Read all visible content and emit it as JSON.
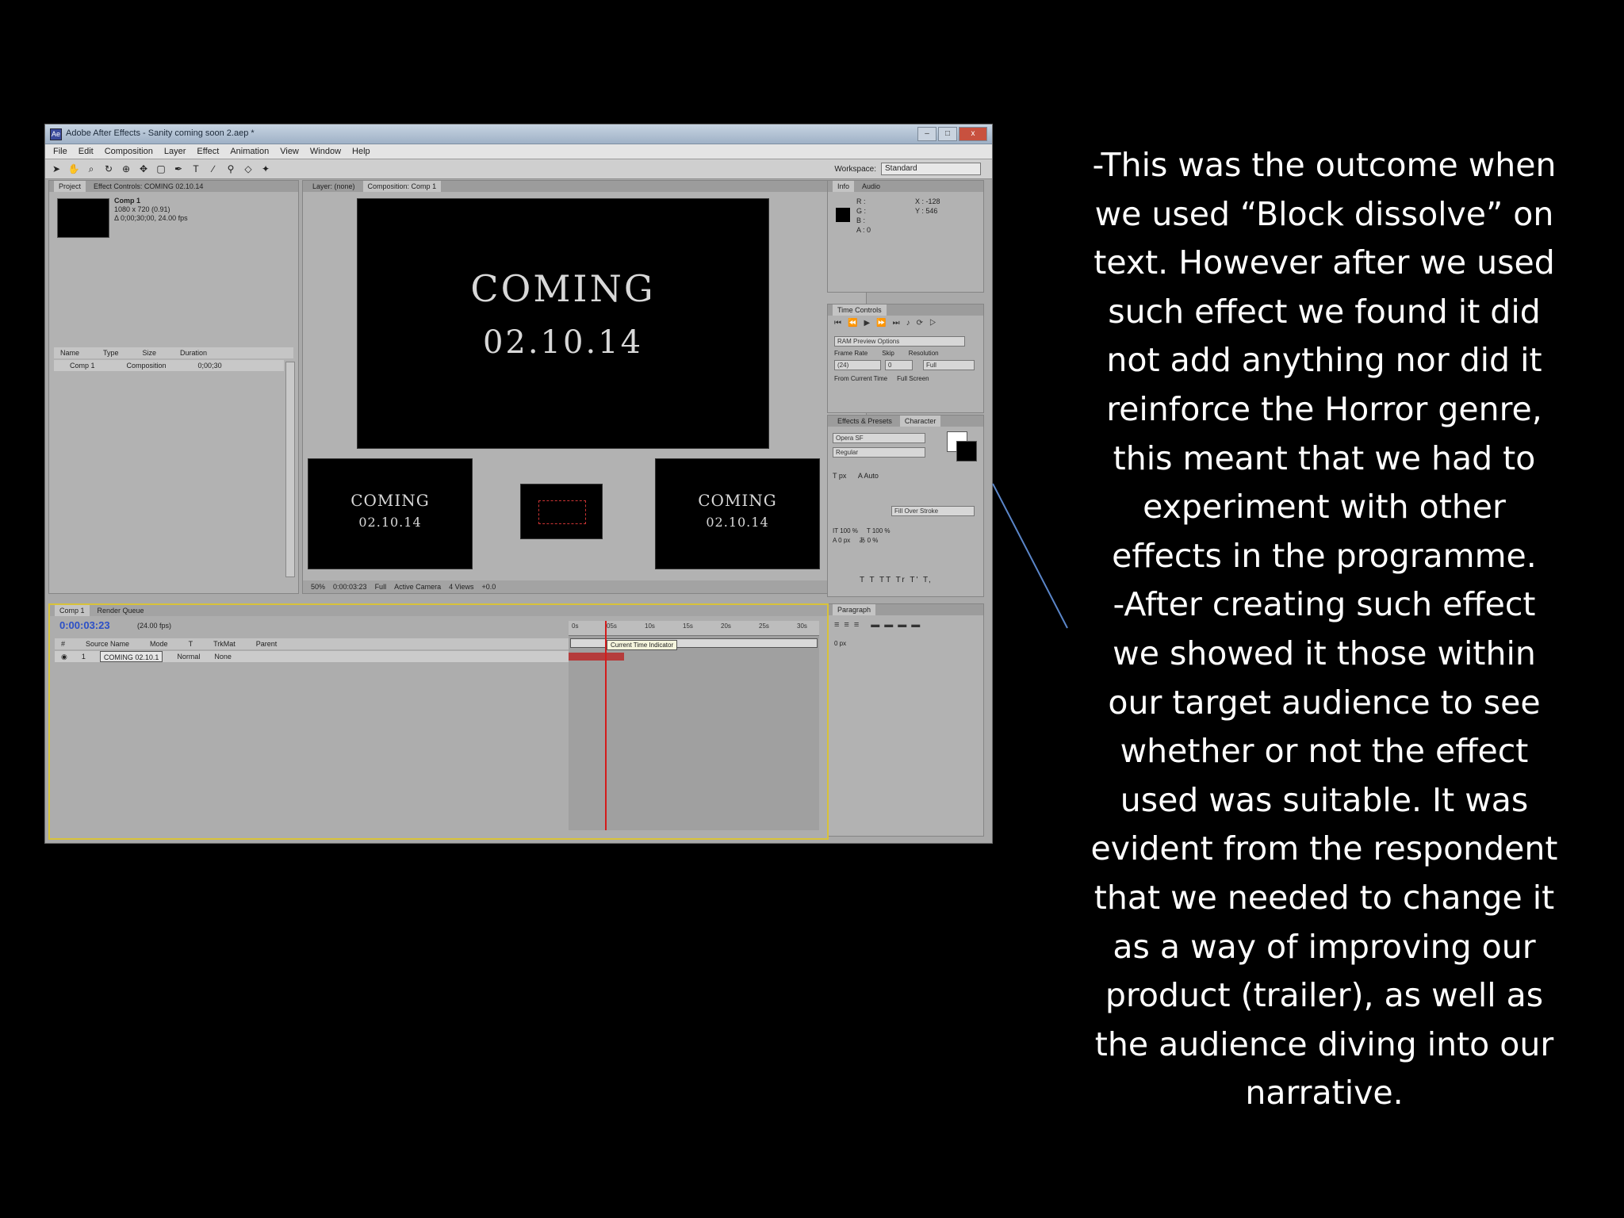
{
  "window": {
    "title": "Adobe After Effects - Sanity coming soon 2.aep *",
    "buttons": {
      "minimize": "–",
      "maximize": "□",
      "close": "x"
    }
  },
  "menu": [
    "File",
    "Edit",
    "Composition",
    "Layer",
    "Effect",
    "Animation",
    "View",
    "Window",
    "Help"
  ],
  "workspace": {
    "label": "Workspace:",
    "value": "Standard"
  },
  "project_panel": {
    "tabs": [
      "Project",
      "Effect Controls: COMING 02.10.14"
    ],
    "comp_name": "Comp 1",
    "comp_size": "1080 x 720 (0.91)",
    "comp_duration": "Δ 0;00;30;00, 24.00 fps",
    "columns": [
      "Name",
      "Type",
      "Size",
      "Duration"
    ],
    "row": {
      "name": "Comp 1",
      "type": "Composition",
      "duration": "0;00;30"
    }
  },
  "composition_panel": {
    "tabs": [
      "Layer: (none)",
      "Composition: Comp 1"
    ],
    "title_text": "COMING",
    "date_text": "02.10.14",
    "status": [
      "50%",
      "0:00:03:23",
      "Full",
      "Active Camera",
      "4 Views",
      "+0.0"
    ]
  },
  "info_panel": {
    "tabs": [
      "Info",
      "Audio"
    ],
    "r": "R :",
    "g": "G :",
    "b": "B :",
    "a": "A : 0",
    "x": "X : -128",
    "y": "Y : 546"
  },
  "time_controls": {
    "tab": "Time Controls",
    "ram_preview": "RAM Preview Options",
    "labels": [
      "Frame Rate",
      "Skip",
      "Resolution"
    ],
    "values": [
      "(24)",
      "0",
      "Full"
    ],
    "checks": [
      "From Current Time",
      "Full Screen"
    ]
  },
  "character_panel": {
    "tabs": [
      "Effects & Presets",
      "Character"
    ],
    "font": "Opera SF",
    "style": "Regular",
    "size": "px",
    "leading": "Auto",
    "stroke": "Fill Over Stroke",
    "scale_v": "100 %",
    "scale_h": "100 %",
    "baseline": "0 px",
    "tsume": "0 %",
    "styles": "T T TT Tr T' T,"
  },
  "paragraph_panel": {
    "tab": "Paragraph",
    "indent": "0 px"
  },
  "timeline": {
    "tabs": [
      "Comp 1",
      "Render Queue"
    ],
    "timecode": "0:00:03:23",
    "fps": "(24.00 fps)",
    "columns": [
      "#",
      "Source Name",
      "Mode",
      "T",
      "TrkMat",
      "Parent"
    ],
    "layer": {
      "index": "1",
      "name": "COMING 02.10.1",
      "mode": "Normal",
      "parent": "None"
    },
    "ruler": [
      "0s",
      "05s",
      "10s",
      "15s",
      "20s",
      "25s",
      "30s"
    ],
    "tooltip": "Current Time Indicator"
  },
  "description": [
    "-This was the outcome when",
    "we used “Block dissolve” on",
    "text. However after we used",
    "such effect we found it did",
    "not add anything nor did it",
    "reinforce the Horror genre,",
    "this meant that we had to",
    "experiment with other",
    "effects in the programme.",
    "-After creating such effect",
    "we showed it those within",
    "our target audience to see",
    "whether or not the effect",
    "used was suitable. It was",
    "evident from the respondent",
    "that we needed to change it",
    "as a way of improving our",
    "product (trailer), as well as",
    "the audience diving into our",
    "narrative."
  ],
  "colors": {
    "background": "#000000",
    "text": "#ffffff",
    "connector": "#5b86c9",
    "timecode": "#2b4fc7"
  }
}
